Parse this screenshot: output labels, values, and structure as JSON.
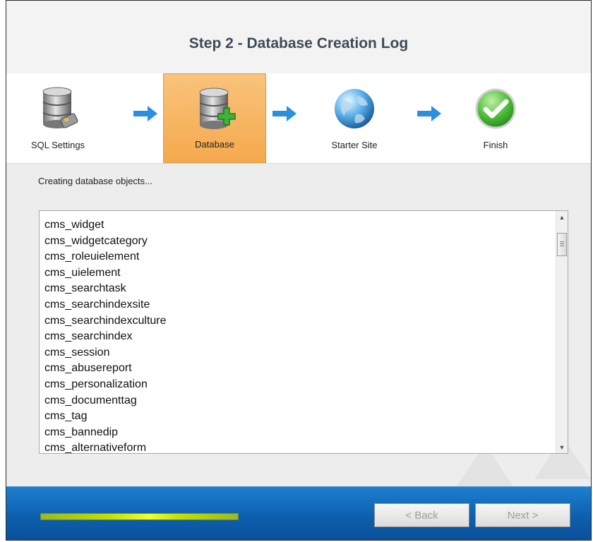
{
  "header": {
    "title": "Step 2 - Database Creation Log"
  },
  "steps": [
    {
      "label": "SQL Settings",
      "icon": "database-connect-icon",
      "active": false
    },
    {
      "label": "Database",
      "icon": "database-add-icon",
      "active": true
    },
    {
      "label": "Starter Site",
      "icon": "globe-icon",
      "active": false
    },
    {
      "label": "Finish",
      "icon": "checkmark-icon",
      "active": false
    }
  ],
  "status_text": "Creating database objects...",
  "log_items": [
    "cms_widget",
    "cms_widgetcategory",
    "cms_roleuielement",
    "cms_uielement",
    "cms_searchtask",
    "cms_searchindexsite",
    "cms_searchindexculture",
    "cms_searchindex",
    "cms_session",
    "cms_abusereport",
    "cms_personalization",
    "cms_documenttag",
    "cms_tag",
    "cms_bannedip",
    "cms_alternativeform"
  ],
  "footer": {
    "back_label": "< Back",
    "next_label": "Next >",
    "back_enabled": false,
    "next_enabled": false
  },
  "colors": {
    "accent_active": "#f5a94d",
    "footer_blue": "#0d5fae",
    "arrow_blue": "#2a8fe0",
    "progress_green": "#c4e000"
  }
}
